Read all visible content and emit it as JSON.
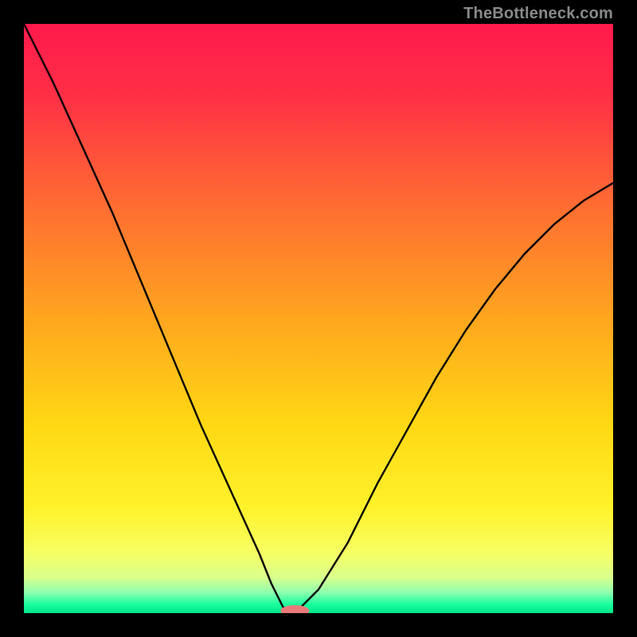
{
  "watermark": "TheBottleneck.com",
  "chart_data": {
    "type": "line",
    "title": "",
    "xlabel": "",
    "ylabel": "",
    "xlim": [
      0,
      100
    ],
    "ylim": [
      0,
      100
    ],
    "x": [
      0,
      5,
      10,
      15,
      20,
      25,
      30,
      35,
      40,
      42,
      44,
      46,
      50,
      55,
      60,
      65,
      70,
      75,
      80,
      85,
      90,
      95,
      100
    ],
    "values": [
      100,
      90,
      79,
      68,
      56,
      44,
      32,
      21,
      10,
      5,
      1,
      0,
      4,
      12,
      22,
      31,
      40,
      48,
      55,
      61,
      66,
      70,
      73
    ],
    "marker": {
      "x": 46,
      "y": 0
    },
    "gradient_stops": [
      {
        "offset": 0.0,
        "color": "#ff1a4b"
      },
      {
        "offset": 0.12,
        "color": "#ff2f46"
      },
      {
        "offset": 0.3,
        "color": "#ff6a33"
      },
      {
        "offset": 0.5,
        "color": "#ffa61f"
      },
      {
        "offset": 0.68,
        "color": "#ffd814"
      },
      {
        "offset": 0.82,
        "color": "#fff22a"
      },
      {
        "offset": 0.9,
        "color": "#f6ff66"
      },
      {
        "offset": 0.94,
        "color": "#d8ff8c"
      },
      {
        "offset": 0.965,
        "color": "#8dffb0"
      },
      {
        "offset": 0.985,
        "color": "#19ff9e"
      },
      {
        "offset": 1.0,
        "color": "#00e68a"
      }
    ]
  }
}
